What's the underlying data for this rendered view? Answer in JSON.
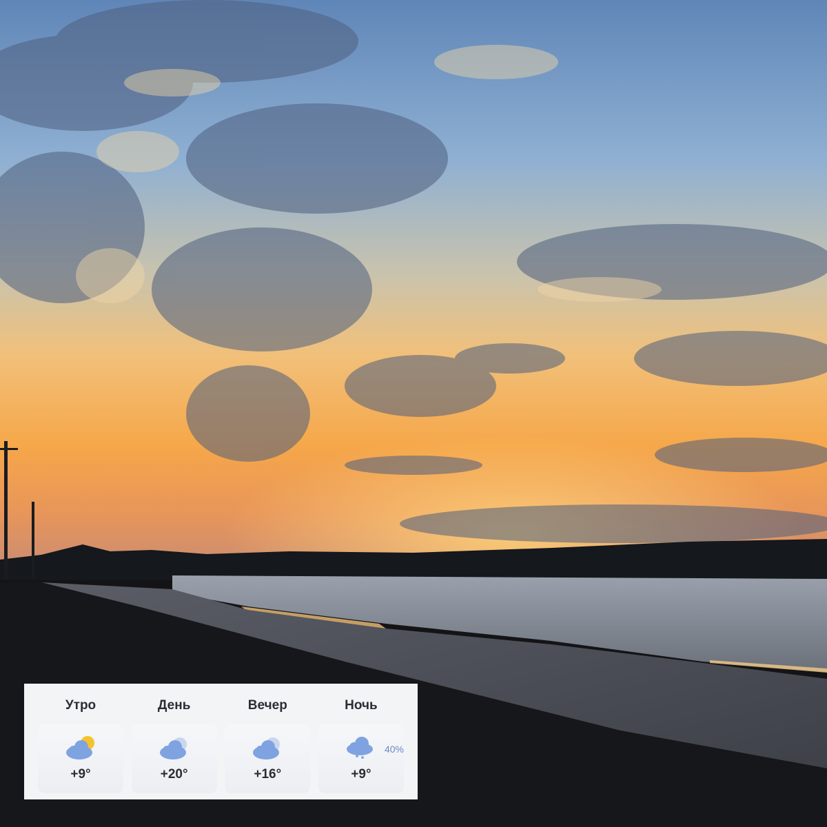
{
  "forecast": {
    "periods": [
      {
        "label": "Утро",
        "icon": "partly-cloudy-sun-icon",
        "temp": "+9°",
        "precip": ""
      },
      {
        "label": "День",
        "icon": "cloudy-icon",
        "temp": "+20°",
        "precip": ""
      },
      {
        "label": "Вечер",
        "icon": "cloudy-icon",
        "temp": "+16°",
        "precip": ""
      },
      {
        "label": "Ночь",
        "icon": "rain-cloud-icon",
        "temp": "+9°",
        "precip": "40%"
      }
    ]
  },
  "colors": {
    "cloud_icon": "#7fa3e0",
    "sun_icon": "#f5c22c",
    "precip_text": "#6d86c8",
    "card_bg": "#f3f4f6"
  }
}
